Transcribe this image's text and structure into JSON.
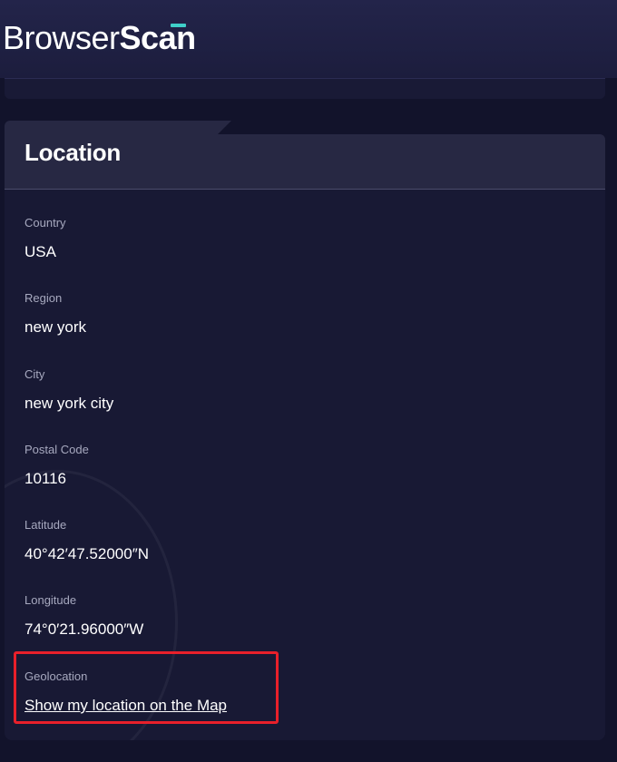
{
  "header": {
    "logo_light": "Browser",
    "logo_bold": "Scan"
  },
  "colors": {
    "background": "#12132b",
    "card": "#181934",
    "card_header": "#272843",
    "accent": "#3fd0c9",
    "highlight": "#e8202a"
  },
  "location": {
    "title": "Location",
    "fields": [
      {
        "label": "Country",
        "value": "USA"
      },
      {
        "label": "Region",
        "value": "new york"
      },
      {
        "label": "City",
        "value": "new york city"
      },
      {
        "label": "Postal Code",
        "value": "10116"
      },
      {
        "label": "Latitude",
        "value": "40°42′47.52000″N"
      },
      {
        "label": "Longitude",
        "value": "74°0′21.96000″W"
      }
    ],
    "geolocation": {
      "label": "Geolocation",
      "link": "Show my location on the Map"
    }
  }
}
